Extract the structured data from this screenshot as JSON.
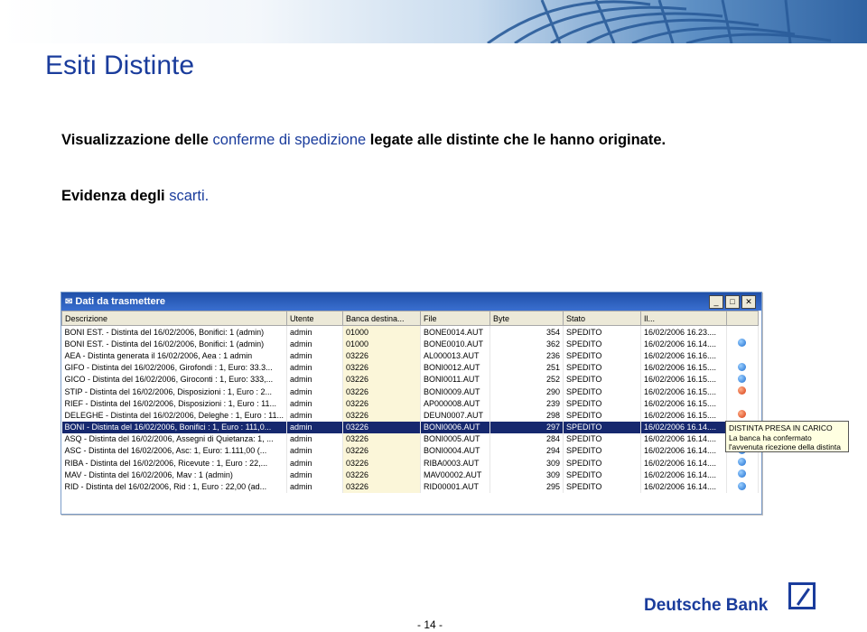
{
  "slide": {
    "title": "Esiti Distinte",
    "line1_a": "Visualizzazione delle ",
    "line1_b": "conferme di spedizione",
    "line1_c": " legate alle distinte che le hanno originate.",
    "line2_a": "Evidenza degli ",
    "line2_b": "scarti.",
    "page_number": "- 14 -",
    "logo_text": "Deutsche Bank"
  },
  "window": {
    "title": "Dati da trasmettere",
    "buttons": [
      "_",
      "□",
      "✕"
    ],
    "columns": [
      "Descrizione",
      "Utente",
      "Banca destina...",
      "File",
      "Byte",
      "Stato",
      "Il..."
    ],
    "rows": [
      {
        "desc": "BONI EST. - Distinta del 16/02/2006, Bonifici: 1 (admin)",
        "user": "admin",
        "banca": "01000",
        "file": "BONE0014.AUT",
        "byte": "354",
        "stato": "SPEDITO",
        "date": "16/02/2006 16.23....",
        "icon": ""
      },
      {
        "desc": "BONI EST. - Distinta del 16/02/2006, Bonifici: 1 (admin)",
        "user": "admin",
        "banca": "01000",
        "file": "BONE0010.AUT",
        "byte": "362",
        "stato": "SPEDITO",
        "date": "16/02/2006 16.14....",
        "icon": "blue"
      },
      {
        "desc": "AEA - Distinta generata il 16/02/2006, Aea : 1 admin",
        "user": "admin",
        "banca": "03226",
        "file": "AL000013.AUT",
        "byte": "236",
        "stato": "SPEDITO",
        "date": "16/02/2006 16.16....",
        "icon": ""
      },
      {
        "desc": "GIFO - Distinta del 16/02/2006, Girofondi : 1, Euro: 33.3...",
        "user": "admin",
        "banca": "03226",
        "file": "BONI0012.AUT",
        "byte": "251",
        "stato": "SPEDITO",
        "date": "16/02/2006 16.15....",
        "icon": "blue"
      },
      {
        "desc": "GICO - Distinta del 16/02/2006, Giroconti : 1, Euro: 333,...",
        "user": "admin",
        "banca": "03226",
        "file": "BONI0011.AUT",
        "byte": "252",
        "stato": "SPEDITO",
        "date": "16/02/2006 16.15....",
        "icon": "blue"
      },
      {
        "desc": "STIP - Distinta del 16/02/2006, Disposizioni : 1, Euro : 2...",
        "user": "admin",
        "banca": "03226",
        "file": "BONI0009.AUT",
        "byte": "290",
        "stato": "SPEDITO",
        "date": "16/02/2006 16.15....",
        "icon": "red"
      },
      {
        "desc": "RIEF - Distinta del 16/02/2006, Disposizioni : 1, Euro : 11...",
        "user": "admin",
        "banca": "03226",
        "file": "AP000008.AUT",
        "byte": "239",
        "stato": "SPEDITO",
        "date": "16/02/2006 16.15....",
        "icon": ""
      },
      {
        "desc": "DELEGHE - Distinta del 16/02/2006, Deleghe : 1, Euro : 11...",
        "user": "admin",
        "banca": "03226",
        "file": "DEUN0007.AUT",
        "byte": "298",
        "stato": "SPEDITO",
        "date": "16/02/2006 16.15....",
        "icon": "red"
      },
      {
        "desc": "BONI - Distinta del 16/02/2006, Bonifici : 1, Euro : 111,0...",
        "user": "admin",
        "banca": "03226",
        "file": "BONI0006.AUT",
        "byte": "297",
        "stato": "SPEDITO",
        "date": "16/02/2006 16.14....",
        "icon": "",
        "selected": true
      },
      {
        "desc": "ASQ - Distinta del 16/02/2006, Assegni di Quietanza: 1, ...",
        "user": "admin",
        "banca": "03226",
        "file": "BONI0005.AUT",
        "byte": "284",
        "stato": "SPEDITO",
        "date": "16/02/2006 16.14....",
        "icon": ""
      },
      {
        "desc": "ASC - Distinta del 16/02/2006, Asc: 1, Euro: 1.111,00 (...",
        "user": "admin",
        "banca": "03226",
        "file": "BONI0004.AUT",
        "byte": "294",
        "stato": "SPEDITO",
        "date": "16/02/2006 16.14....",
        "icon": "blue"
      },
      {
        "desc": "RIBA - Distinta del 16/02/2006, Ricevute : 1, Euro : 22,...",
        "user": "admin",
        "banca": "03226",
        "file": "RIBA0003.AUT",
        "byte": "309",
        "stato": "SPEDITO",
        "date": "16/02/2006 16.14....",
        "icon": "blue"
      },
      {
        "desc": "MAV - Distinta del 16/02/2006, Mav : 1 (admin)",
        "user": "admin",
        "banca": "03226",
        "file": "MAV00002.AUT",
        "byte": "309",
        "stato": "SPEDITO",
        "date": "16/02/2006 16.14....",
        "icon": "blue"
      },
      {
        "desc": "RID - Distinta del 16/02/2006, Rid : 1, Euro : 22,00 (ad...",
        "user": "admin",
        "banca": "03226",
        "file": "RID00001.AUT",
        "byte": "295",
        "stato": "SPEDITO",
        "date": "16/02/2006 16.14....",
        "icon": "blue"
      }
    ],
    "tooltip": {
      "line1": "DISTINTA PRESA IN CARICO",
      "line2": "La banca ha confermato",
      "line3": "l'avvenuta ricezione della distinta"
    }
  }
}
